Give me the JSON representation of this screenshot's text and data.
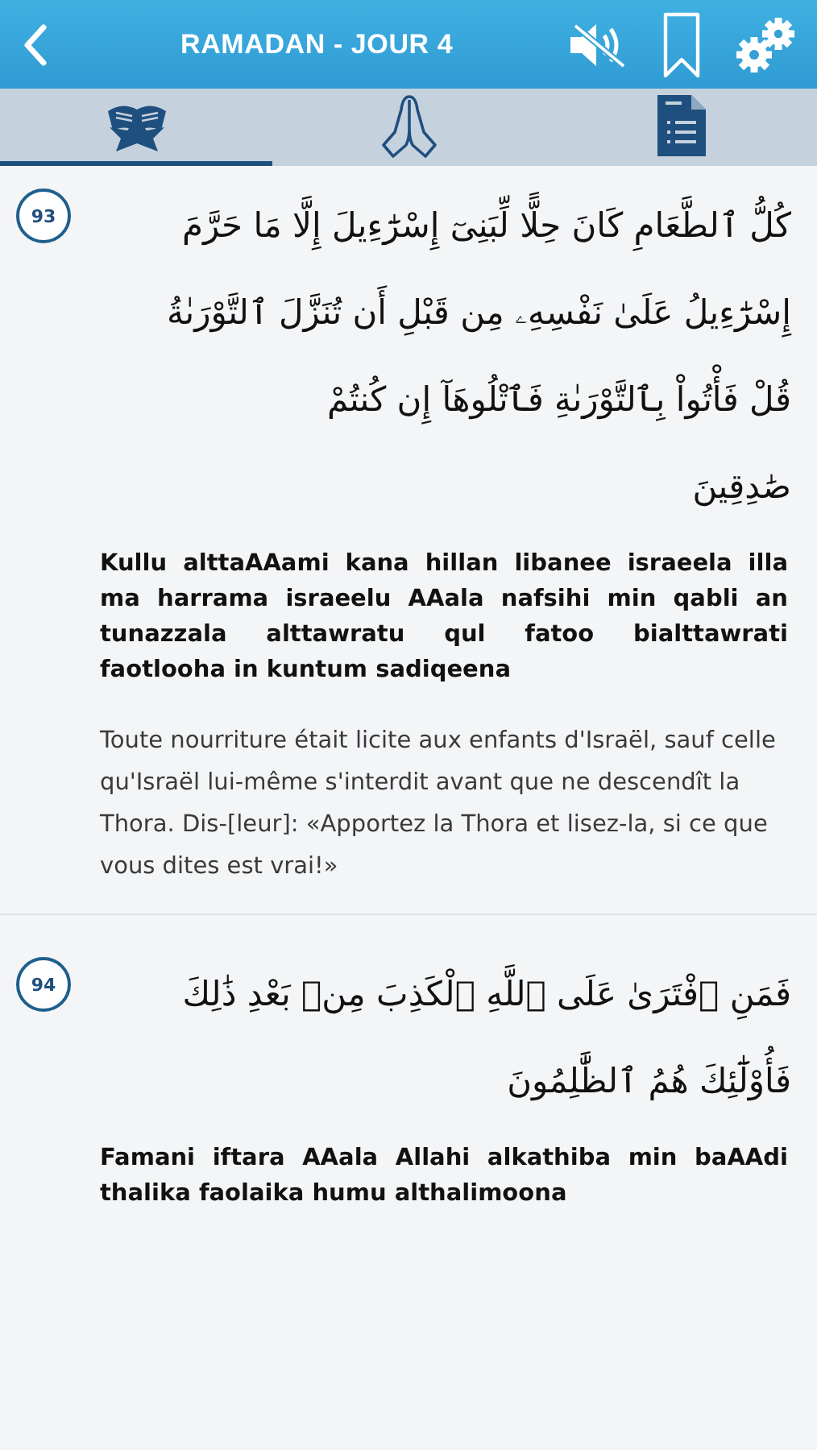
{
  "header": {
    "title": "RAMADAN - JOUR 4"
  },
  "tabs": [
    {
      "kind": "quran",
      "selected": true
    },
    {
      "kind": "prayer",
      "selected": false
    },
    {
      "kind": "document",
      "selected": false
    }
  ],
  "verses": [
    {
      "number": "93",
      "arabic_lines": [
        "كُلُّ ٱلطَّعَامِ كَانَ حِلًّا لِّبَنِىٓ إِسْرَٰٓءِيلَ إِلَّا مَا حَرَّمَ",
        "إِسْرَٰٓءِيلُ عَلَىٰ نَفْسِهِۦ مِن قَبْلِ أَن تُنَزَّلَ ٱلتَّوْرَىٰةُ",
        "قُلْ فَأْتُواْ بِٱلتَّوْرَىٰةِ فَٱتْلُوهَآ إِن كُنتُمْ",
        "صَٰدِقِينَ"
      ],
      "transliteration": "Kullu alttaAAami kana hillan libanee israeela illa ma harrama israeelu AAala nafsihi min qabli an tunazzala alttawratu qul fatoo bi**al**ttawrati fa**o**tlooha in kuntum sadiqeen**a**",
      "translation": "Toute nourriture était licite aux enfants d'Israël, sauf celle qu'Israël lui-même s'interdit avant que ne descendît la Thora. Dis-[leur]: «Apportez la Thora et lisez-la, si ce que vous dites est vrai!»"
    },
    {
      "number": "94",
      "arabic_lines": [
        "فَمَنِ ٱفْتَرَىٰ عَلَى ٱللَّهِ ٱلْكَذِبَ مِنۢ بَعْدِ ذَٰلِكَ",
        "فَأُوْلَٰٓئِكَ هُمُ ٱلظَّٰلِمُونَ"
      ],
      "transliteration": "Famani iftara AAala Allahi alkathiba min baAAdi thalika faolaika humu althalimoon**a**"
    }
  ]
}
